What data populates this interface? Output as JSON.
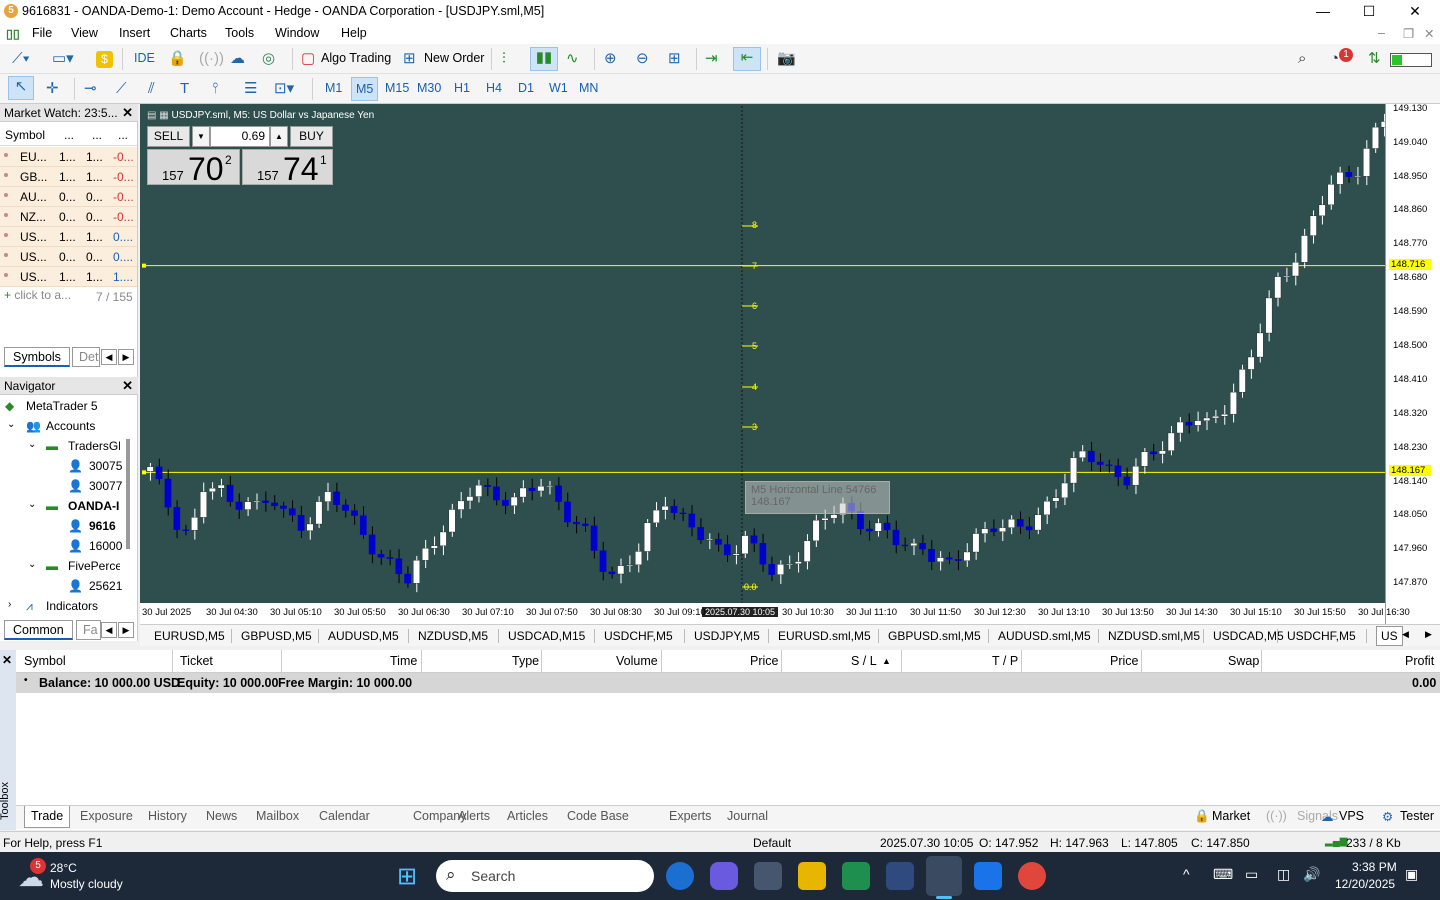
{
  "title_bar": {
    "title": "9616831 - OANDA-Demo-1: Demo Account - Hedge - OANDA Corporation - [USDJPY.sml,M5]",
    "minimize": "—",
    "maximize": "☐",
    "close": "✕"
  },
  "menu": [
    "File",
    "View",
    "Insert",
    "Charts",
    "Tools",
    "Window",
    "Help"
  ],
  "toolbar": {
    "ide": "IDE",
    "algo_trading": "Algo Trading",
    "new_order": "New Order",
    "timeframes": [
      "M1",
      "M5",
      "M15",
      "M30",
      "H1",
      "H4",
      "D1",
      "W1",
      "MN"
    ],
    "active_timeframe": "M5",
    "notification_count": "1"
  },
  "market_watch": {
    "header": "Market Watch: 23:5...",
    "columns": [
      "Symbol",
      "...",
      "...",
      "..."
    ],
    "rows": [
      {
        "symbol": "EU...",
        "bid": "1...",
        "ask": "1...",
        "chg": "-0..."
      },
      {
        "symbol": "GB...",
        "bid": "1...",
        "ask": "1...",
        "chg": "-0..."
      },
      {
        "symbol": "AU...",
        "bid": "0...",
        "ask": "0...",
        "chg": "-0..."
      },
      {
        "symbol": "NZ...",
        "bid": "0...",
        "ask": "0...",
        "chg": "-0..."
      },
      {
        "symbol": "US...",
        "bid": "1...",
        "ask": "1...",
        "chg": "0...."
      },
      {
        "symbol": "US...",
        "bid": "0...",
        "ask": "0...",
        "chg": "0...."
      },
      {
        "symbol": "US...",
        "bid": "1...",
        "ask": "1...",
        "chg": "1...."
      }
    ],
    "add_symbol": "click to a...",
    "count": "7 / 155",
    "tabs": [
      "Symbols",
      "Det"
    ]
  },
  "navigator": {
    "header": "Navigator",
    "root": "MetaTrader 5",
    "accounts": "Accounts",
    "groups": [
      {
        "name": "TradersGlo",
        "accounts": [
          "30075",
          "30077"
        ]
      },
      {
        "name": "OANDA-I",
        "accounts": [
          "9616",
          "16000"
        ]
      },
      {
        "name": "FivePerce",
        "accounts": [
          "25621"
        ]
      }
    ],
    "indicators": "Indicators",
    "tabs": [
      "Common",
      "Fa"
    ]
  },
  "chart": {
    "title": "USDJPY.sml, M5:  US Dollar vs Japanese Yen",
    "sell_label": "SELL",
    "buy_label": "BUY",
    "lot": "0.69",
    "sell_price_small": "157",
    "sell_price_big": "70",
    "sell_price_sup": "2",
    "buy_price_small": "157",
    "buy_price_big": "74",
    "buy_price_sup": "1",
    "tooltip_line1": "M5 Horizontal Line 54766",
    "tooltip_line2": "148.167",
    "crosshair_time": "2025.07.30 10:05",
    "hline_labels": [
      "148.716",
      "148.167"
    ],
    "fib_labels": [
      "8",
      "7",
      "6",
      "5",
      "4",
      "3",
      "0.0"
    ],
    "colors": {
      "background": "#2f4f4f",
      "bull": "#ffffff",
      "bear": "#0000cc",
      "hline": "#ffff00"
    }
  },
  "chart_data": {
    "type": "candlestick",
    "symbol": "USDJPY.sml",
    "timeframe": "M5",
    "y_ticks": [
      "149.130",
      "149.040",
      "148.950",
      "148.860",
      "148.770",
      "148.680",
      "148.590",
      "148.500",
      "148.410",
      "148.320",
      "148.230",
      "148.140",
      "148.050",
      "147.960",
      "147.870"
    ],
    "x_ticks": [
      "30 Jul 2025",
      "30 Jul 04:30",
      "30 Jul 05:10",
      "30 Jul 05:50",
      "30 Jul 06:30",
      "30 Jul 07:10",
      "30 Jul 07:50",
      "30 Jul 08:30",
      "30 Jul 09:10",
      "30 Jul 10:30",
      "30 Jul 11:10",
      "30 Jul 11:50",
      "30 Jul 12:30",
      "30 Jul 13:10",
      "30 Jul 13:50",
      "30 Jul 14:30",
      "30 Jul 15:10",
      "30 Jul 15:50",
      "30 Jul 16:30"
    ],
    "ylim": [
      147.82,
      149.14
    ],
    "horizontal_lines": [
      148.716,
      148.167
    ],
    "close_path": [
      148.17,
      148.1,
      148.04,
      148.0,
      148.13,
      148.12,
      148.08,
      148.11,
      148.07,
      148.09,
      148.05,
      148.03,
      148.06,
      148.1,
      148.08,
      148.04,
      148.0,
      147.94,
      147.9,
      147.88,
      147.95,
      148.0,
      148.03,
      148.08,
      148.14,
      148.12,
      148.1,
      148.08,
      148.12,
      148.15,
      148.1,
      148.04,
      148.0,
      147.94,
      147.9,
      147.92,
      147.96,
      148.03,
      148.1,
      148.06,
      148.02,
      147.98,
      147.95,
      147.97,
      148.0,
      147.94,
      147.88,
      147.92,
      147.97,
      148.02,
      148.05,
      148.07,
      148.05,
      148.03,
      148.01,
      147.98,
      147.96,
      147.98,
      147.94,
      147.91,
      147.95,
      148.0,
      148.04,
      148.02,
      148.01,
      148.03,
      148.08,
      148.13,
      148.18,
      148.21,
      148.2,
      148.17,
      148.15,
      148.18,
      148.22,
      148.26,
      148.3,
      148.31,
      148.28,
      148.33,
      148.4,
      148.46,
      148.56,
      148.66,
      148.72,
      148.78,
      148.86,
      148.92,
      148.95,
      148.98,
      149.05,
      149.1
    ]
  },
  "chart_tabs": [
    "EURUSD,M5",
    "GBPUSD,M5",
    "AUDUSD,M5",
    "NZDUSD,M5",
    "USDCAD,M15",
    "USDCHF,M5",
    "USDJPY,M5",
    "EURUSD.sml,M5",
    "GBPUSD.sml,M5",
    "AUDUSD.sml,M5",
    "NZDUSD.sml,M5",
    "USDCAD,M5",
    "USDCHF,M5",
    "US"
  ],
  "toolbox": {
    "columns": [
      "Symbol",
      "Ticket",
      "Time",
      "Type",
      "Volume",
      "Price",
      "S / L",
      "T / P",
      "Price",
      "Swap",
      "Profit"
    ],
    "balance": "Balance: 10 000.00 USD",
    "equity": "Equity: 10 000.00",
    "free_margin": "Free Margin: 10 000.00",
    "profit": "0.00",
    "side_label": "Toolbox",
    "tabs": [
      "Trade",
      "Exposure",
      "History",
      "News",
      "Mailbox",
      "Calendar",
      "Company",
      "Alerts",
      "Articles",
      "Code Base",
      "Experts",
      "Journal"
    ],
    "right_tabs": [
      "Market",
      "Signals",
      "VPS",
      "Tester"
    ]
  },
  "status_bar": {
    "help": "For Help, press F1",
    "profile": "Default",
    "datetime": "2025.07.30 10:05",
    "open": "O: 147.952",
    "high": "H: 147.963",
    "low": "L: 147.805",
    "close": "C: 147.850",
    "traffic": "233 / 8 Kb"
  },
  "taskbar": {
    "weather_temp": "28°C",
    "weather_desc": "Mostly cloudy",
    "weather_badge": "5",
    "search": "Search",
    "time": "3:38 PM",
    "date": "12/20/2025"
  }
}
